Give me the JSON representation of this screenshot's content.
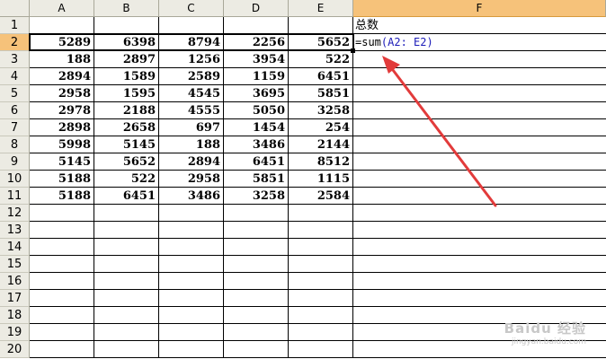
{
  "columns": [
    "A",
    "B",
    "C",
    "D",
    "E",
    "F"
  ],
  "active_column": "F",
  "rows": [
    "1",
    "2",
    "3",
    "4",
    "5",
    "6",
    "7",
    "8",
    "9",
    "10",
    "11",
    "12",
    "13",
    "14",
    "15",
    "16",
    "17",
    "18",
    "19",
    "20"
  ],
  "active_row": "2",
  "f1_label": "总数",
  "f2_formula_prefix": "=sum",
  "f2_formula_args": "(A2: E2)",
  "data": [
    [
      "5289",
      "6398",
      "8794",
      "2256",
      "5652"
    ],
    [
      "188",
      "2897",
      "1256",
      "3954",
      "522"
    ],
    [
      "2894",
      "1589",
      "2589",
      "1159",
      "6451"
    ],
    [
      "2958",
      "1595",
      "4545",
      "3695",
      "5851"
    ],
    [
      "2978",
      "2188",
      "4555",
      "5050",
      "3258"
    ],
    [
      "2898",
      "2658",
      "697",
      "1454",
      "254"
    ],
    [
      "5998",
      "5145",
      "188",
      "3486",
      "2144"
    ],
    [
      "5145",
      "5652",
      "2894",
      "6451",
      "8512"
    ],
    [
      "5188",
      "522",
      "2958",
      "5851",
      "1115"
    ],
    [
      "5188",
      "6451",
      "3486",
      "3258",
      "2584"
    ]
  ],
  "watermark": "Baidu 经验",
  "watermark_url": "jingyan.baidu.com",
  "colors": {
    "active_header": "#f6c27a",
    "arrow": "#e23b3b",
    "formula_ref": "#1b1bb8"
  }
}
